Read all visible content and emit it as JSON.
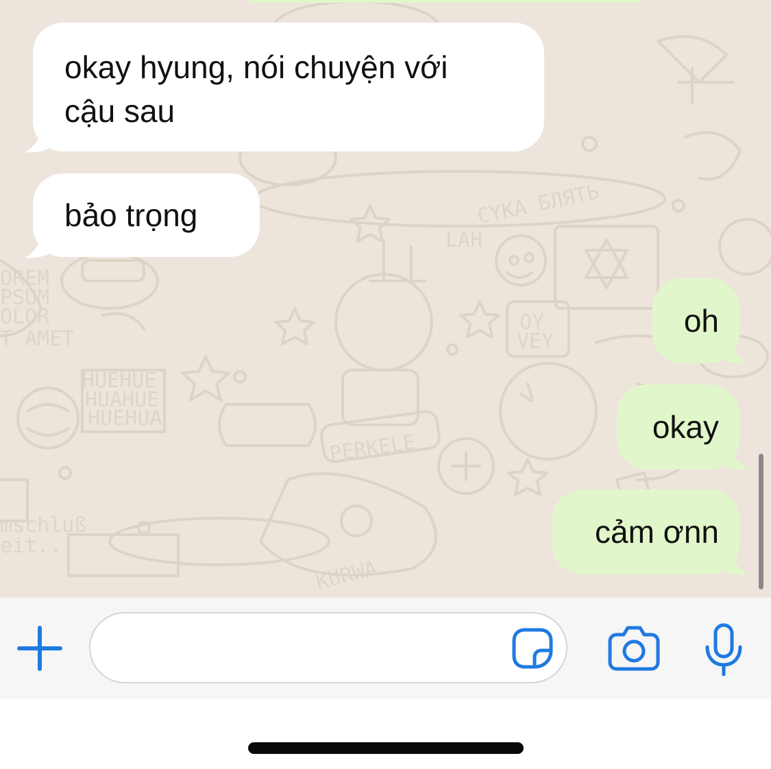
{
  "messages": [
    {
      "direction": "incoming",
      "text": "okay hyung, nói chuyện với\ncậu sau"
    },
    {
      "direction": "incoming",
      "text": "bảo trọng"
    },
    {
      "direction": "outgoing",
      "text": "oh"
    },
    {
      "direction": "outgoing",
      "text": "okay"
    },
    {
      "direction": "outgoing",
      "text": "cảm ơnn"
    }
  ],
  "input_bar": {
    "message_value": "",
    "message_placeholder": "",
    "icons": [
      "plus-icon",
      "sticker-icon",
      "camera-icon",
      "microphone-icon"
    ]
  },
  "theme": {
    "chat_background": "#ede5dc",
    "incoming_bubble": "#ffffff",
    "outgoing_bubble": "#e1f7cb",
    "accent": "#1f7ae0"
  }
}
